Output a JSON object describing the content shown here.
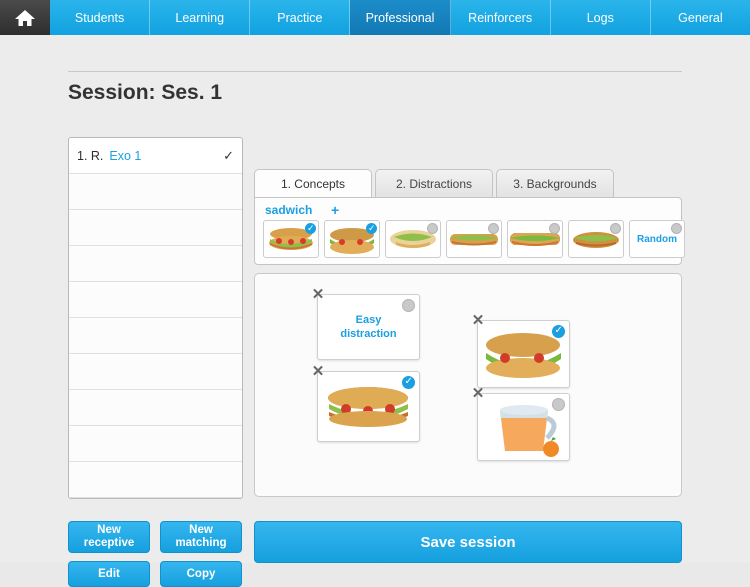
{
  "nav": {
    "home_icon": "home-icon",
    "items": [
      {
        "label": "Students",
        "active": false
      },
      {
        "label": "Learning",
        "active": false
      },
      {
        "label": "Practice",
        "active": false
      },
      {
        "label": "Professional",
        "active": true
      },
      {
        "label": "Reinforcers",
        "active": false
      },
      {
        "label": "Logs",
        "active": false
      },
      {
        "label": "General",
        "active": false
      }
    ]
  },
  "page": {
    "title": "Session: Ses. 1"
  },
  "exercise_list": {
    "rows": [
      {
        "index": "1. R.",
        "label": "Exo 1",
        "check": "✓"
      }
    ],
    "empty_rows": 9
  },
  "tabs": [
    {
      "label": "1. Concepts",
      "active": true
    },
    {
      "label": "2. Distractions",
      "active": false
    },
    {
      "label": "3. Backgrounds",
      "active": false
    }
  ],
  "concept": {
    "word": "sadwich",
    "add": "+",
    "thumbnails": [
      {
        "name": "sandwich-thumb-1",
        "selected": true,
        "art": "sandwich-sub-tomato"
      },
      {
        "name": "sandwich-thumb-2",
        "selected": true,
        "art": "sandwich-open-salad"
      },
      {
        "name": "sandwich-thumb-3",
        "selected": false,
        "art": "sandwich-wrap"
      },
      {
        "name": "sandwich-thumb-4",
        "selected": false,
        "art": "sandwich-baguette"
      },
      {
        "name": "sandwich-thumb-5",
        "selected": false,
        "art": "sandwich-long"
      },
      {
        "name": "sandwich-thumb-6",
        "selected": false,
        "art": "sandwich-roll"
      },
      {
        "name": "random-thumb",
        "selected": false,
        "art": "random",
        "label": "Random"
      }
    ]
  },
  "workspace": {
    "cards": [
      {
        "name": "easy-distraction-card",
        "text": "Easy\ndistraction",
        "selected": false,
        "close": "✕",
        "art": "text"
      },
      {
        "name": "sandwich-card-left",
        "text": "",
        "selected": true,
        "close": "✕",
        "art": "sandwich-sub-tomato"
      },
      {
        "name": "sandwich-card-right",
        "text": "",
        "selected": true,
        "close": "✕",
        "art": "sandwich-open-salad"
      },
      {
        "name": "juice-card",
        "text": "",
        "selected": false,
        "close": "✕",
        "art": "juice-pitcher"
      }
    ]
  },
  "buttons": {
    "new_receptive": "New receptive",
    "new_matching": "New matching",
    "edit": "Edit",
    "copy": "Copy",
    "save_session": "Save session"
  },
  "colors": {
    "accent": "#15a0de",
    "nav_active": "#1278b4",
    "page_bg": "#ececec",
    "link": "#1a9fe0"
  }
}
